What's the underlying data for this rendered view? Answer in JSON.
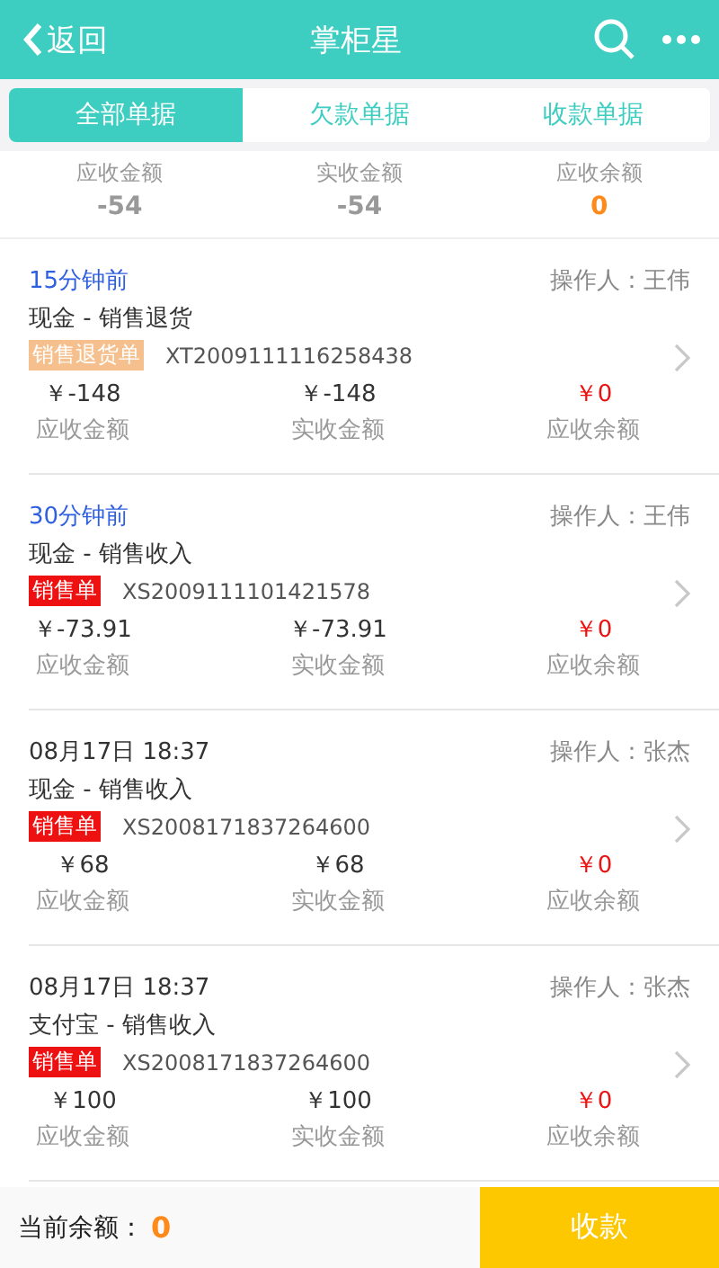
{
  "header": {
    "back": "返回",
    "title": "掌柜星"
  },
  "tabs": [
    {
      "label": "全部单据",
      "selected": true
    },
    {
      "label": "欠款单据",
      "selected": false
    },
    {
      "label": "收款单据",
      "selected": false
    }
  ],
  "summary": [
    {
      "label": "应收金额",
      "value": "-54",
      "highlight": false
    },
    {
      "label": "实收金额",
      "value": "-54",
      "highlight": false
    },
    {
      "label": "应收余额",
      "value": "0",
      "highlight": true
    }
  ],
  "records": [
    {
      "time": "15分钟前",
      "recent": true,
      "operator": "操作人：王伟",
      "type": "现金 - 销售退货",
      "badge": {
        "kind": "return",
        "text": "销售退货单"
      },
      "number": "XT2009111116258438",
      "amounts": [
        {
          "value": "￥-148",
          "label": "应收金额",
          "alert": false
        },
        {
          "value": "￥-148",
          "label": "实收金额",
          "alert": false
        },
        {
          "value": "￥0",
          "label": "应收余额",
          "alert": true
        }
      ]
    },
    {
      "time": "30分钟前",
      "recent": true,
      "operator": "操作人：王伟",
      "type": "现金 - 销售收入",
      "badge": {
        "kind": "sale",
        "text": "销售单"
      },
      "number": "XS2009111101421578",
      "amounts": [
        {
          "value": "￥-73.91",
          "label": "应收金额",
          "alert": false
        },
        {
          "value": "￥-73.91",
          "label": "实收金额",
          "alert": false
        },
        {
          "value": "￥0",
          "label": "应收余额",
          "alert": true
        }
      ]
    },
    {
      "time": "08月17日 18:37",
      "recent": false,
      "operator": "操作人：张杰",
      "type": "现金 - 销售收入",
      "badge": {
        "kind": "sale",
        "text": "销售单"
      },
      "number": "XS2008171837264600",
      "amounts": [
        {
          "value": "￥68",
          "label": "应收金额",
          "alert": false
        },
        {
          "value": "￥68",
          "label": "实收金额",
          "alert": false
        },
        {
          "value": "￥0",
          "label": "应收余额",
          "alert": true
        }
      ]
    },
    {
      "time": "08月17日 18:37",
      "recent": false,
      "operator": "操作人：张杰",
      "type": "支付宝 - 销售收入",
      "badge": {
        "kind": "sale",
        "text": "销售单"
      },
      "number": "XS2008171837264600",
      "amounts": [
        {
          "value": "￥100",
          "label": "应收金额",
          "alert": false
        },
        {
          "value": "￥100",
          "label": "实收金额",
          "alert": false
        },
        {
          "value": "￥0",
          "label": "应收余额",
          "alert": true
        }
      ]
    }
  ],
  "footer": {
    "label": "当前余额：",
    "value": "0",
    "button": "收款"
  }
}
